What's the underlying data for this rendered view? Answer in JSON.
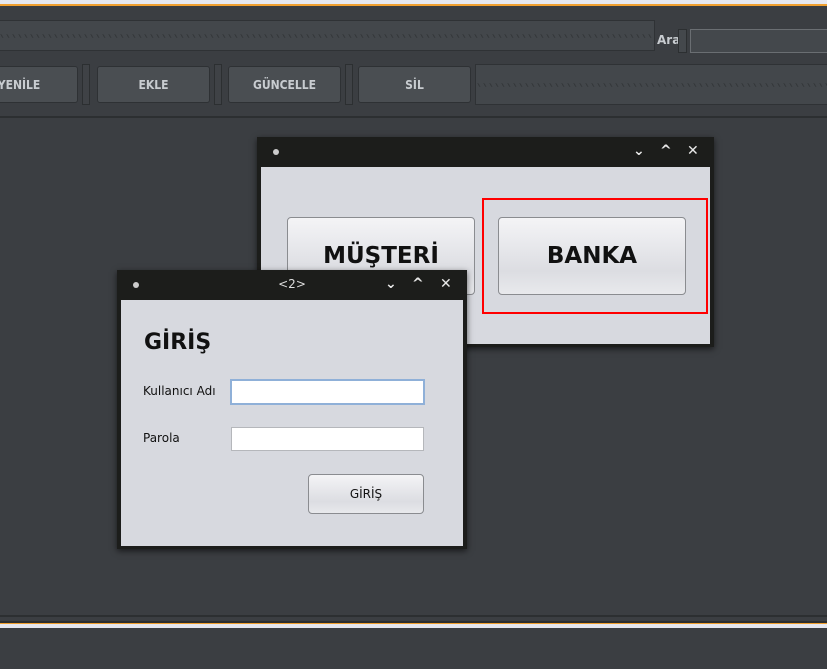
{
  "toolbar": {
    "search_label": "Ara",
    "search_value": "",
    "buttons": [
      "YENİLE",
      "EKLE",
      "GÜNCELLE",
      "SİL"
    ]
  },
  "main_window": {
    "title": "",
    "buttons": [
      "MÜŞTERİ",
      "BANKA"
    ]
  },
  "login_window": {
    "title": "<2>",
    "heading": "GİRİŞ",
    "username_label": "Kullanıcı Adı",
    "username_value": "",
    "password_label": "Parola",
    "password_value": "",
    "submit_label": "GİRİŞ"
  },
  "colors": {
    "background": "#3b3e42",
    "accent": "#f0a030",
    "highlight": "#ff0000"
  }
}
